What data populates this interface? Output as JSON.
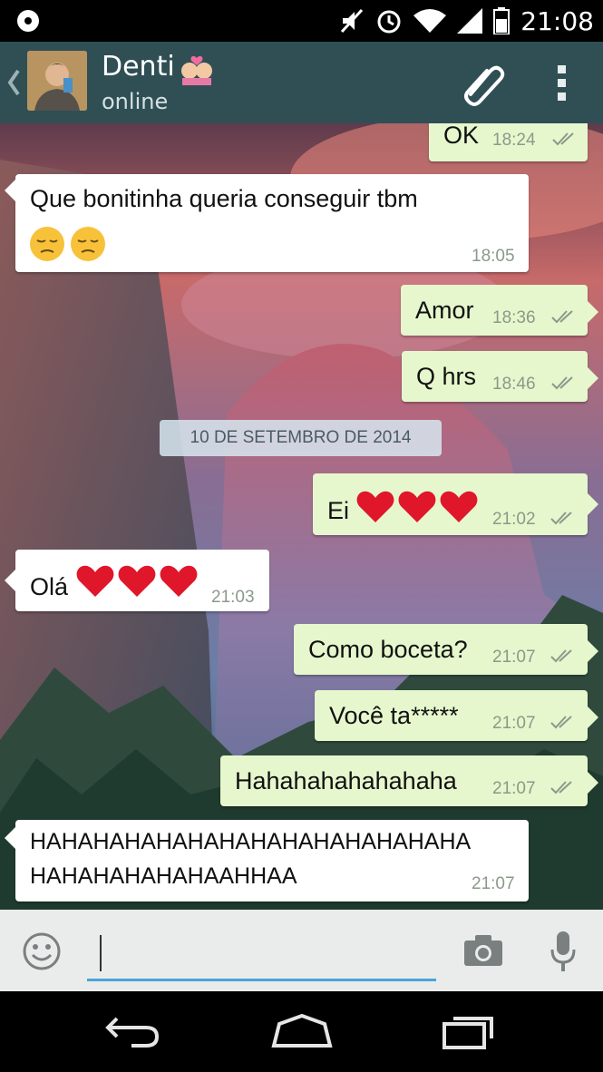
{
  "status_bar": {
    "time": "21:08"
  },
  "header": {
    "contact_name": "Denti",
    "contact_status": "online"
  },
  "date_chip": "10 DE SETEMBRO DE 2014",
  "messages": [
    {
      "dir": "out",
      "text": "OK",
      "time": "18:24"
    },
    {
      "dir": "in",
      "text": "Que bonitinha queria conseguir tbm",
      "time": "18:05"
    },
    {
      "dir": "out",
      "text": "Amor",
      "time": "18:36"
    },
    {
      "dir": "out",
      "text": "Q hrs",
      "time": "18:46"
    },
    {
      "dir": "out",
      "text": "Ei",
      "time": "21:02"
    },
    {
      "dir": "in",
      "text": "Olá",
      "time": "21:03"
    },
    {
      "dir": "out",
      "text": "Como boceta?",
      "time": "21:07"
    },
    {
      "dir": "out",
      "text": "Você ta*****",
      "time": "21:07"
    },
    {
      "dir": "out",
      "text": "Hahahahahahahaha",
      "time": "21:07"
    },
    {
      "dir": "in",
      "text": "HAHAHAHAHAHAHAHAHAHAHAHAHAHA",
      "text2": "HAHAHAHAHAHAAHHAA",
      "time": "21:07"
    }
  ],
  "icons": {
    "status_left": "notification-icon",
    "muted": "vibrate-off-icon",
    "alarm": "alarm-icon",
    "wifi": "wifi-icon",
    "signal": "signal-icon",
    "battery": "battery-icon",
    "back": "chevron-left-icon",
    "attach": "paperclip-icon",
    "menu": "overflow-menu-icon",
    "emoji": "smiley-icon",
    "camera": "camera-icon",
    "mic": "microphone-icon",
    "nav_back": "nav-back-icon",
    "nav_home": "nav-home-icon",
    "nav_recent": "nav-recent-icon"
  },
  "colors": {
    "header": "#2f4f55",
    "incoming": "#ffffff",
    "outgoing": "#e6f7cd",
    "input_accent": "#4aa3d8"
  }
}
